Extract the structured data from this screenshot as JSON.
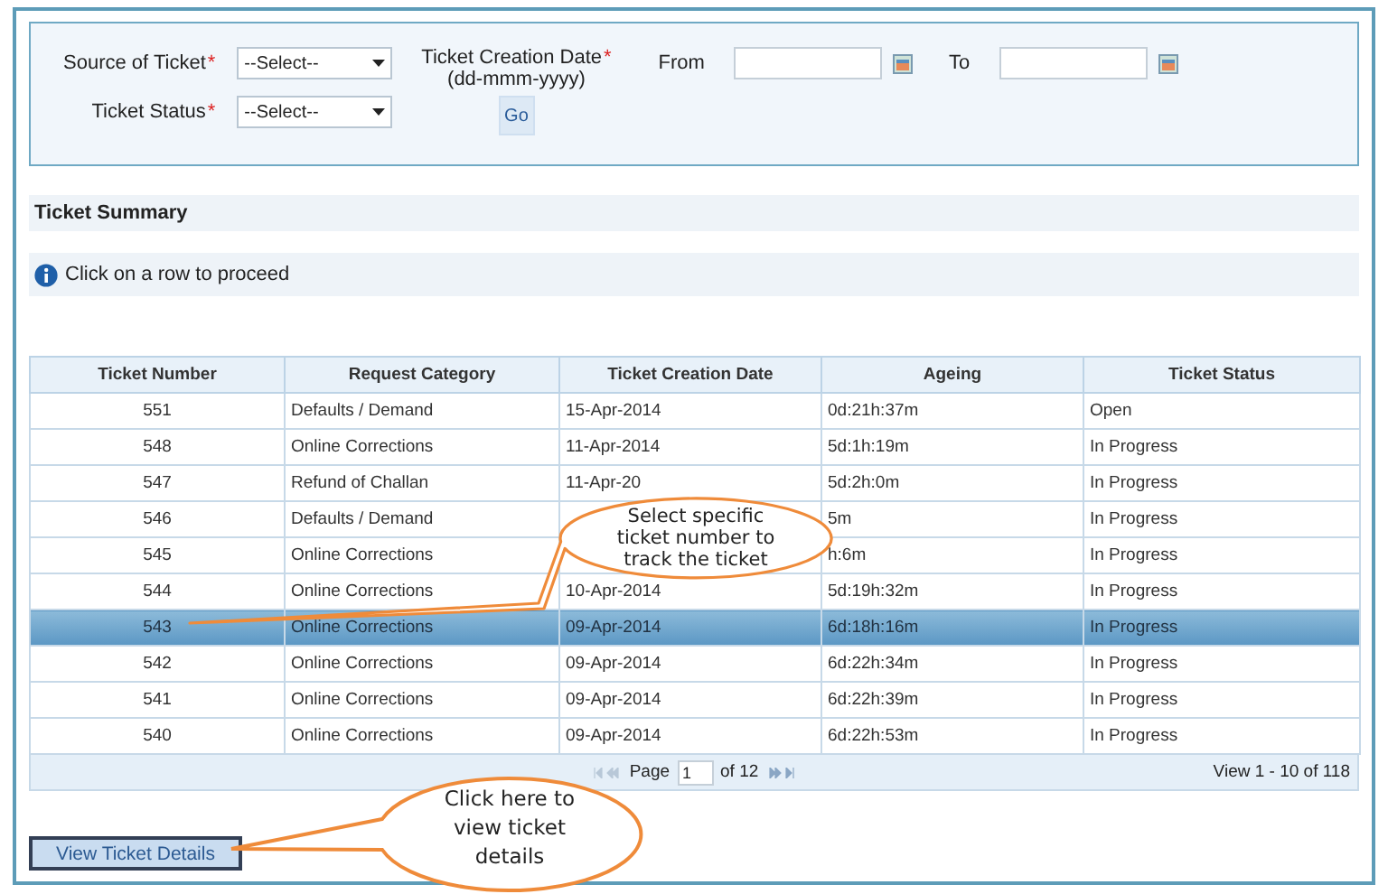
{
  "filters": {
    "source": {
      "label": "Source of Ticket",
      "required_mark": "*",
      "value": "--Select--"
    },
    "status": {
      "label": "Ticket Status",
      "required_mark": "*",
      "value": "--Select--"
    },
    "date": {
      "label": "Ticket Creation Date",
      "required_mark": "*",
      "format": "(dd-mmm-yyyy)",
      "from_label": "From",
      "to_label": "To"
    },
    "go_button": "Go"
  },
  "summary": {
    "title": "Ticket Summary",
    "info": "Click on a row to proceed"
  },
  "table": {
    "columns": [
      "Ticket Number",
      "Request Category",
      "Ticket Creation Date",
      "Ageing",
      "Ticket Status"
    ],
    "rows": [
      {
        "ticket_number": "551",
        "request_category": "Defaults / Demand",
        "creation_date": "15-Apr-2014",
        "ageing": "0d:21h:37m",
        "status": "Open",
        "selected": false
      },
      {
        "ticket_number": "548",
        "request_category": "Online Corrections",
        "creation_date": "11-Apr-2014",
        "ageing": "5d:1h:19m",
        "status": "In Progress",
        "selected": false
      },
      {
        "ticket_number": "547",
        "request_category": "Refund of Challan",
        "creation_date": "11-Apr-20",
        "ageing": "5d:2h:0m",
        "status": "In Progress",
        "selected": false
      },
      {
        "ticket_number": "546",
        "request_category": "Defaults / Demand",
        "ageing": "5m",
        "status": "In Progress",
        "selected": false
      },
      {
        "ticket_number": "545",
        "request_category": "Online Corrections",
        "ageing": "h:6m",
        "status": "In Progress",
        "selected": false
      },
      {
        "ticket_number": "544",
        "request_category": "Online Corrections",
        "creation_date": "10-Apr-2014",
        "ageing": "5d:19h:32m",
        "status": "In Progress",
        "selected": false
      },
      {
        "ticket_number": "543",
        "request_category": "Online Corrections",
        "creation_date": "09-Apr-2014",
        "ageing": "6d:18h:16m",
        "status": "In Progress",
        "selected": true
      },
      {
        "ticket_number": "542",
        "request_category": "Online Corrections",
        "creation_date": "09-Apr-2014",
        "ageing": "6d:22h:34m",
        "status": "In Progress",
        "selected": false
      },
      {
        "ticket_number": "541",
        "request_category": "Online Corrections",
        "creation_date": "09-Apr-2014",
        "ageing": "6d:22h:39m",
        "status": "In Progress",
        "selected": false
      },
      {
        "ticket_number": "540",
        "request_category": "Online Corrections",
        "creation_date": "09-Apr-2014",
        "ageing": "6d:22h:53m",
        "status": "In Progress",
        "selected": false
      }
    ],
    "pager": {
      "page_label": "Page",
      "page": "1",
      "of_label": "of 12",
      "view": "View 1 - 10 of 118"
    }
  },
  "view_button": "View Ticket Details",
  "callouts": [
    {
      "text": "Select specific ticket number to track the ticket"
    },
    {
      "text": "Click here to view ticket details"
    }
  ]
}
